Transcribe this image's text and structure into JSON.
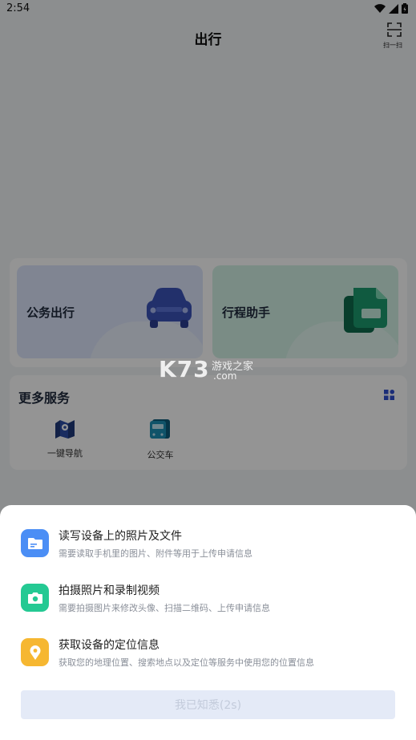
{
  "status_bar": {
    "time": "2:54"
  },
  "header": {
    "title": "出行",
    "scan_label": "扫一扫"
  },
  "cards": [
    {
      "title": "公务出行"
    },
    {
      "title": "行程助手"
    }
  ],
  "services": {
    "title": "更多服务",
    "items": [
      {
        "label": "一键导航"
      },
      {
        "label": "公交车"
      }
    ]
  },
  "watermark": {
    "logo": "K73",
    "cn": "游戏之家",
    "domain": ".com"
  },
  "permission_sheet": {
    "items": [
      {
        "title": "读写设备上的照片及文件",
        "desc": "需要读取手机里的图片、附件等用于上传申请信息",
        "color": "#4b8ef5"
      },
      {
        "title": "拍摄照片和录制视频",
        "desc": "需要拍摄图片来修改头像、扫描二维码、上传申请信息",
        "color": "#24c993"
      },
      {
        "title": "获取设备的定位信息",
        "desc": "获取您的地理位置、搜索地点以及定位等服务中使用您的位置信息",
        "color": "#f6b731"
      }
    ],
    "confirm_label": "我已知悉(2s)"
  }
}
